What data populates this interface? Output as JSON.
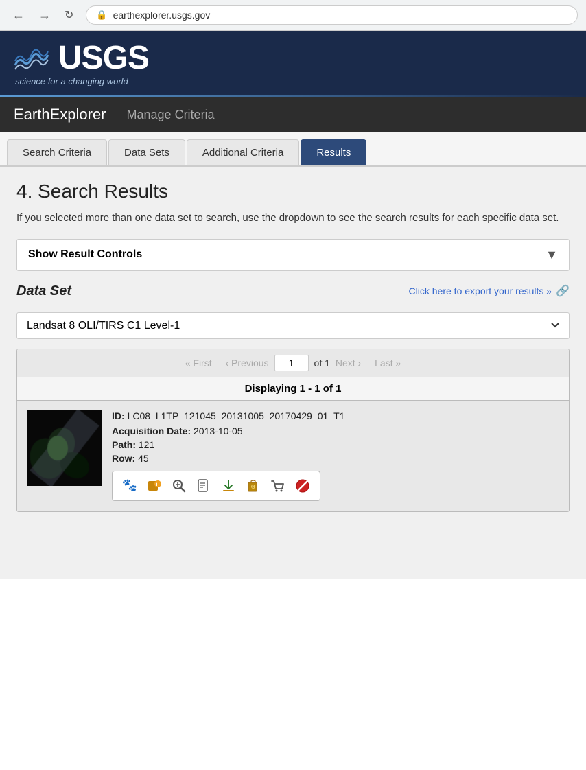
{
  "browser": {
    "url": "earthexplorer.usgs.gov"
  },
  "usgs": {
    "name": "USGS",
    "tagline": "science for a changing world"
  },
  "navbar": {
    "title": "EarthExplorer",
    "manage_criteria": "Manage Criteria"
  },
  "tabs": [
    {
      "id": "search-criteria",
      "label": "Search Criteria",
      "active": false
    },
    {
      "id": "data-sets",
      "label": "Data Sets",
      "active": false
    },
    {
      "id": "additional-criteria",
      "label": "Additional Criteria",
      "active": false
    },
    {
      "id": "results",
      "label": "Results",
      "active": true
    }
  ],
  "results": {
    "title": "4. Search Results",
    "description": "If you selected more than one data set to search, use the dropdown to see the search results for each specific data set.",
    "show_result_controls": "Show Result Controls",
    "dataset_label": "Data Set",
    "export_link": "Click here to export your results »",
    "dataset_selected": "Landsat 8 OLI/TIRS C1 Level-1",
    "pagination": {
      "first": "« First",
      "previous": "‹ Previous",
      "page": "1",
      "of": "of 1",
      "next": "Next ›",
      "last": "Last »"
    },
    "displaying": "Displaying 1 - 1 of 1",
    "items": [
      {
        "id": "LC08_L1TP_121045_20131005_20170429_01_T1",
        "acquisition_date": "2013-10-05",
        "path": "121",
        "row": "45"
      }
    ],
    "labels": {
      "id": "ID:",
      "acquisition_date": "Acquisition Date:",
      "path": "Path:",
      "row": "Row:"
    }
  },
  "action_icons": [
    {
      "name": "footprint-icon",
      "symbol": "🐾",
      "label": "Footprint"
    },
    {
      "name": "preview-icon",
      "symbol": "🔶",
      "label": "Preview"
    },
    {
      "name": "zoom-icon",
      "symbol": "🔍",
      "label": "Zoom"
    },
    {
      "name": "metadata-icon",
      "symbol": "📋",
      "label": "Metadata"
    },
    {
      "name": "download-icon",
      "symbol": "⬇",
      "label": "Download"
    },
    {
      "name": "order-icon",
      "symbol": "🏷",
      "label": "Order"
    },
    {
      "name": "cart-icon",
      "symbol": "🛒",
      "label": "Cart"
    },
    {
      "name": "exclude-icon",
      "symbol": "🚫",
      "label": "Exclude"
    }
  ]
}
